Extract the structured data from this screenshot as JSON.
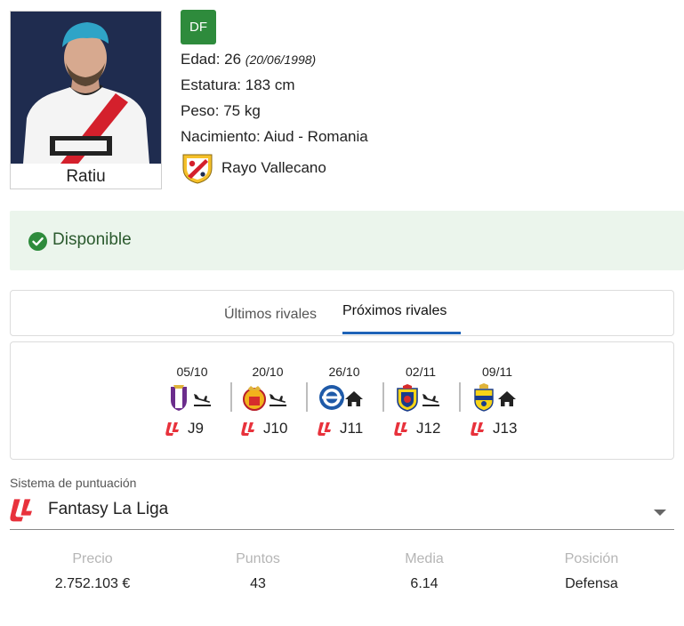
{
  "player": {
    "name": "Ratiu",
    "position_badge": "DF",
    "age_text": "Edad: 26",
    "dob_text": "(20/06/1998)",
    "height_text": "Estatura: 183 cm",
    "weight_text": "Peso: 75 kg",
    "birthplace_text": "Nacimiento: Aiud - Romania",
    "team": "Rayo Vallecano",
    "badge_color": "#2e8b3c"
  },
  "status": {
    "text": "Disponible",
    "icon": "check-circle-icon",
    "color": "#2e8b3c"
  },
  "tabs": {
    "last": "Últimos rivales",
    "next": "Próximos rivales",
    "active": "next",
    "accent": "#1e63b8"
  },
  "fixtures": [
    {
      "date": "05/10",
      "opponent_icon": "real-valladolid-crest-icon",
      "venue": "away",
      "venue_icon": "plane-landing-icon",
      "round": "J9"
    },
    {
      "date": "20/10",
      "opponent_icon": "rcd-mallorca-crest-icon",
      "venue": "away",
      "venue_icon": "plane-landing-icon",
      "round": "J10"
    },
    {
      "date": "26/10",
      "opponent_icon": "deportivo-alaves-crest-icon",
      "venue": "home",
      "venue_icon": "home-icon",
      "round": "J11"
    },
    {
      "date": "02/11",
      "opponent_icon": "villarreal-crest-icon",
      "venue": "away",
      "venue_icon": "plane-landing-icon",
      "round": "J12"
    },
    {
      "date": "09/11",
      "opponent_icon": "ud-las-palmas-crest-icon",
      "venue": "home",
      "venue_icon": "home-icon",
      "round": "J13"
    }
  ],
  "scoring": {
    "label": "Sistema de puntuación",
    "value": "Fantasy La Liga",
    "icon": "laliga-logo-icon"
  },
  "stats": {
    "price_label": "Precio",
    "price_value": "2.752.103 €",
    "points_label": "Puntos",
    "points_value": "43",
    "avg_label": "Media",
    "avg_value": "6.14",
    "pos_label": "Posición",
    "pos_value": "Defensa"
  }
}
